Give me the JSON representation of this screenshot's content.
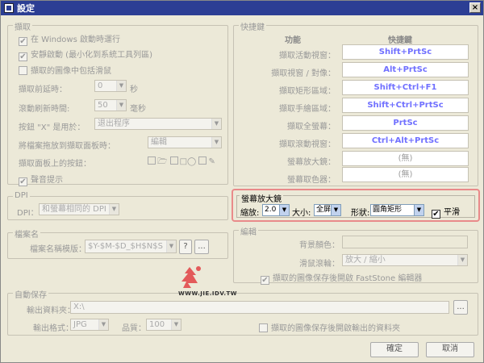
{
  "window": {
    "title": "設定",
    "close_label": "×"
  },
  "capture": {
    "group_title": "擷取",
    "opt_start_windows": "在 Windows 啟動時運行",
    "opt_start_minimized": "安靜啟動 (最小化到系統工具列區)",
    "opt_include_cursor": "擷取的圖像中包括滑鼠",
    "delay_label": "擷取前延時：",
    "delay_value": "0",
    "delay_unit": "秒",
    "scroll_label": "滾動刷新時間:",
    "scroll_value": "50",
    "scroll_unit": "毫秒",
    "x_button_label": "按鈕 \"X\" 是用於：",
    "x_button_value": "退出程序",
    "drag_label": "將檔案拖放到擷取面板時：",
    "drag_value": "編輯",
    "panel_buttons_label": "擷取面板上的按鈕：",
    "sound_label": "聲音提示"
  },
  "dpi": {
    "group_title": "DPI",
    "label": "DPI：",
    "value": "和螢幕相同的 DPI"
  },
  "filename": {
    "group_title": "檔案名",
    "label": "檔案名稱模版：",
    "value": "$Y-$M-$D_$H$N$S",
    "help_label": "?",
    "more_label": "..."
  },
  "autosave": {
    "group_title": "自動保存",
    "folder_label": "輸出資料夾：",
    "folder_value": "X:\\",
    "browse_label": "...",
    "format_label": "輸出格式：",
    "format_value": "JPG",
    "quality_label": "品質：",
    "quality_value": "100",
    "open_after_label": "擷取的圖像保存後開啟輸出的資料夾"
  },
  "hotkeys": {
    "group_title": "快捷鍵",
    "col_function": "功能",
    "col_hotkey": "快捷鍵",
    "rows": [
      {
        "label": "擷取活動視窗：",
        "key": "Shift+PrtSc"
      },
      {
        "label": "擷取視窗 / 對像：",
        "key": "Alt+PrtSc"
      },
      {
        "label": "擷取矩形區域：",
        "key": "Shift+Ctrl+F1"
      },
      {
        "label": "擷取手繪區域：",
        "key": "Shift+Ctrl+PrtSc"
      },
      {
        "label": "擷取全螢幕：",
        "key": "PrtSc"
      },
      {
        "label": "擷取滾動視窗：",
        "key": "Ctrl+Alt+PrtSc"
      },
      {
        "label": "螢幕放大鏡：",
        "key": "(無)"
      },
      {
        "label": "螢幕取色器：",
        "key": "(無)"
      }
    ]
  },
  "magnifier": {
    "group_title": "螢幕放大鏡",
    "zoom_label": "縮放:",
    "zoom_value": "2.0",
    "size_label": "大小:",
    "size_value": "全屏",
    "shape_label": "形狀:",
    "shape_value": "圓角矩形",
    "smooth_label": "平滑"
  },
  "editor": {
    "group_title": "編輯",
    "bg_label": "背景顏色：",
    "wheel_label": "滑鼠滾輪：",
    "wheel_value": "放大 / 縮小",
    "open_faststone_label": "擷取的圖像保存後開啟 FastStone 編輯器"
  },
  "footer": {
    "ok_label": "確定",
    "cancel_label": "取消"
  },
  "watermark": {
    "text": "WWW.JIE.IDV.TW"
  },
  "colors": {
    "accent_hotkey": "#7070ff",
    "highlight_border": "#e98a8a",
    "titlebar": "#2c3e94"
  }
}
